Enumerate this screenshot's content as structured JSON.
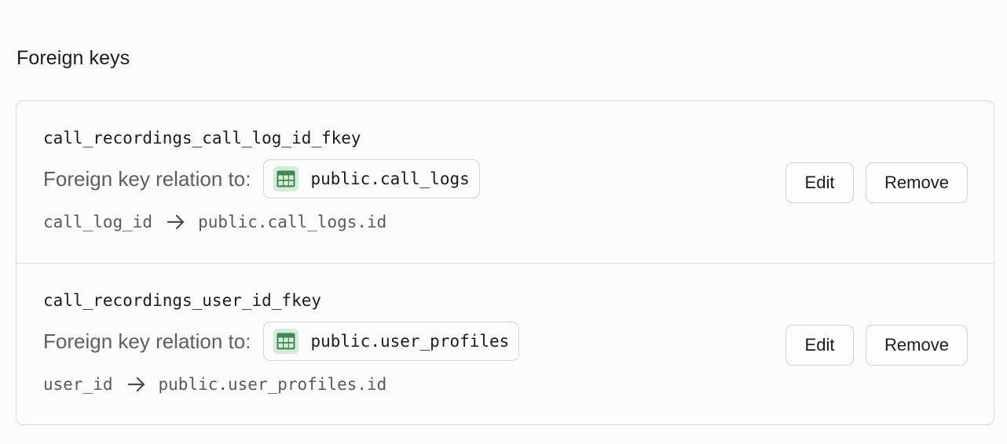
{
  "section": {
    "title": "Foreign keys"
  },
  "foreign_keys": [
    {
      "name": "call_recordings_call_log_id_fkey",
      "relation_label": "Foreign key relation to:",
      "target_table": "public.call_logs",
      "source_column": "call_log_id",
      "target_column": "public.call_logs.id",
      "edit_label": "Edit",
      "remove_label": "Remove"
    },
    {
      "name": "call_recordings_user_id_fkey",
      "relation_label": "Foreign key relation to:",
      "target_table": "public.user_profiles",
      "source_column": "user_id",
      "target_column": "public.user_profiles.id",
      "edit_label": "Edit",
      "remove_label": "Remove"
    }
  ],
  "icons": {
    "table": "table-icon",
    "arrow": "arrow-right-icon"
  },
  "colors": {
    "table_icon_bg": "#d4ecd9",
    "table_icon_fg": "#3f8a53"
  }
}
